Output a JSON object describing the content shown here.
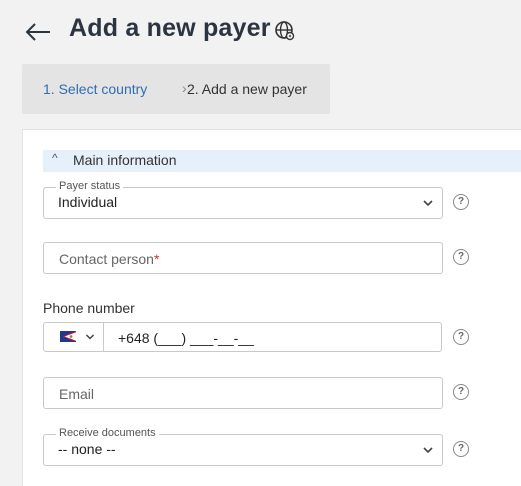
{
  "header": {
    "back_icon": "arrow-left-icon",
    "title": "Add a new payer",
    "language_icon": "globe-icon"
  },
  "breadcrumb": {
    "step1": "1. Select country",
    "separator": "›",
    "step2": "2. Add a new payer"
  },
  "section": {
    "caret": "^",
    "label": "Main information",
    "background": "#e6f0fa"
  },
  "form": {
    "payer_status": {
      "legend": "Payer status",
      "value": "Individual"
    },
    "contact_person": {
      "placeholder": "Contact person",
      "required_mark": "*"
    },
    "phone": {
      "label": "Phone number",
      "country_flag": "american-samoa-flag-icon",
      "value": "+648 (___) ___-__-__"
    },
    "email": {
      "placeholder": "Email"
    },
    "receive_documents": {
      "legend": "Receive documents",
      "value": "-- none --"
    },
    "help_glyph": "?"
  },
  "colors": {
    "link": "#2f6db3",
    "title": "#2b3440",
    "required": "#c0392b"
  }
}
